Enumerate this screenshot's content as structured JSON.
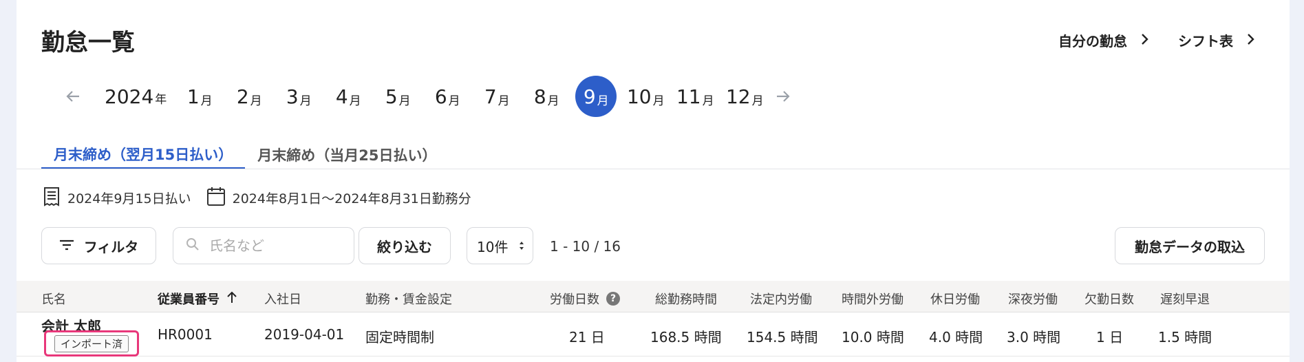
{
  "page_title": "勤怠一覧",
  "top_links": [
    {
      "label": "自分の勤怠"
    },
    {
      "label": "シフト表"
    }
  ],
  "year": {
    "value": "2024",
    "unit": "年"
  },
  "months": [
    {
      "num": "1",
      "unit": "月"
    },
    {
      "num": "2",
      "unit": "月"
    },
    {
      "num": "3",
      "unit": "月"
    },
    {
      "num": "4",
      "unit": "月"
    },
    {
      "num": "5",
      "unit": "月"
    },
    {
      "num": "6",
      "unit": "月"
    },
    {
      "num": "7",
      "unit": "月"
    },
    {
      "num": "8",
      "unit": "月"
    },
    {
      "num": "9",
      "unit": "月"
    },
    {
      "num": "10",
      "unit": "月"
    },
    {
      "num": "11",
      "unit": "月"
    },
    {
      "num": "12",
      "unit": "月"
    }
  ],
  "selected_month": "9",
  "tabs": [
    {
      "label": "月末締め（翌月15日払い）"
    },
    {
      "label": "月末締め（当月25日払い）"
    }
  ],
  "pay_date": "2024年9月15日払い",
  "work_period": "2024年8月1日〜2024年8月31日勤務分",
  "toolbar": {
    "filter_label": "フィルタ",
    "search_placeholder": "氏名など",
    "narrow_label": "絞り込む",
    "page_size": "10件",
    "range": "1 - 10 / 16",
    "import_label": "勤怠データの取込"
  },
  "columns": [
    "氏名",
    "従業員番号",
    "入社日",
    "勤務・賃金設定",
    "労働日数",
    "総勤務時間",
    "法定内労働",
    "時間外労働",
    "休日労働",
    "深夜労働",
    "欠勤日数",
    "遅刻早退"
  ],
  "rows": [
    {
      "name": "会計 太郎",
      "badge": "インポート済",
      "employee_no": "HR0001",
      "hire_date": "2019-04-01",
      "wage_setting": "固定時間制",
      "work_days": "21 日",
      "total_hours": "168.5 時間",
      "legal_hours": "154.5 時間",
      "overtime": "10.0 時間",
      "holiday": "4.0 時間",
      "night": "3.0 時間",
      "absence": "1 日",
      "late_early": "1.5 時間"
    }
  ],
  "colors": {
    "accent": "#2d5ec9",
    "badge_highlight": "#e8377a"
  }
}
